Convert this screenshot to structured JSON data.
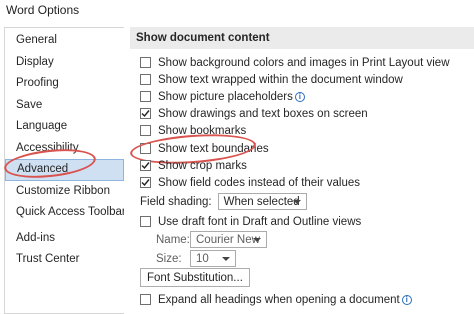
{
  "window": {
    "title": "Word Options"
  },
  "nav": {
    "items": [
      {
        "label": "General"
      },
      {
        "label": "Display"
      },
      {
        "label": "Proofing"
      },
      {
        "label": "Save"
      },
      {
        "label": "Language"
      },
      {
        "label": "Accessibility"
      },
      {
        "label": "Advanced",
        "selected": true
      },
      {
        "label": "Customize Ribbon"
      },
      {
        "label": "Quick Access Toolbar"
      },
      {
        "label": "Add-ins"
      },
      {
        "label": "Trust Center"
      }
    ]
  },
  "section": {
    "title": "Show document content"
  },
  "options": [
    {
      "label": "Show background colors and images in Print Layout view",
      "checked": false
    },
    {
      "label": "Show text wrapped within the document window",
      "checked": false
    },
    {
      "label": "Show picture placeholders",
      "checked": false,
      "info": true
    },
    {
      "label": "Show drawings and text boxes on screen",
      "checked": true
    },
    {
      "label": "Show bookmarks",
      "checked": false
    },
    {
      "label": "Show text boundaries",
      "checked": false
    },
    {
      "label": "Show crop marks",
      "checked": true
    },
    {
      "label": "Show field codes instead of their values",
      "checked": true
    }
  ],
  "field_shading": {
    "label": "Field shading:",
    "value": "When selected"
  },
  "draft_font": {
    "label": "Use draft font in Draft and Outline views",
    "checked": false
  },
  "name": {
    "label": "Name:",
    "value": "Courier New"
  },
  "size": {
    "label": "Size:",
    "value": "10"
  },
  "font_substitution": {
    "label": "Font Substitution..."
  },
  "expand_headings": {
    "label": "Expand all headings when opening a document",
    "checked": false,
    "info": true
  },
  "colors": {
    "annotation": "#d9534f",
    "selected_bg": "#cfe0f3",
    "header_bg": "#ebebeb",
    "info": "#2a6dc0"
  }
}
